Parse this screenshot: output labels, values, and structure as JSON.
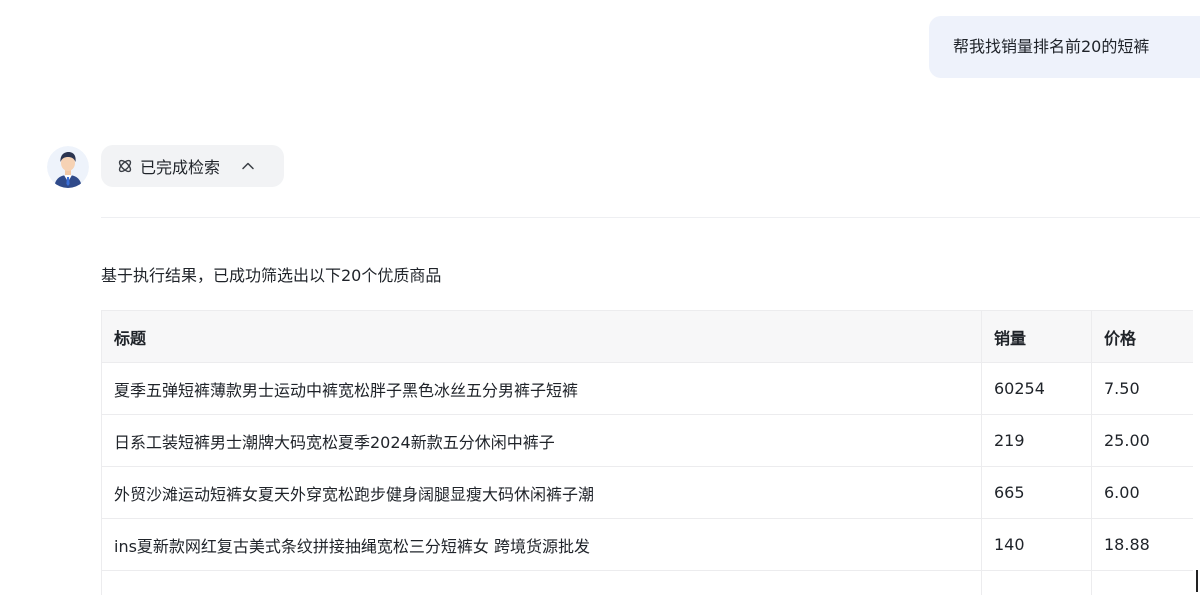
{
  "user_message": "帮我找销量排名前20的短裤",
  "assistant": {
    "avatar_icon": "user-avatar-icon",
    "status_label": "已完成检索",
    "status_icon": "search-done-icon",
    "collapse_icon": "chevron-up-icon",
    "summary": "基于执行结果，已成功筛选出以下20个优质商品"
  },
  "table": {
    "headers": {
      "title": "标题",
      "sales": "销量",
      "price": "价格"
    },
    "rows": [
      {
        "title": "夏季五弹短裤薄款男士运动中裤宽松胖子黑色冰丝五分男裤子短裤",
        "sales": "60254",
        "price": "7.50"
      },
      {
        "title": "日系工装短裤男士潮牌大码宽松夏季2024新款五分休闲中裤子",
        "sales": "219",
        "price": "25.00"
      },
      {
        "title": "外贸沙滩运动短裤女夏天外穿宽松跑步健身阔腿显瘦大码休闲裤子潮",
        "sales": "665",
        "price": "6.00"
      },
      {
        "title": "ins夏新款网红复古美式条纹拼接抽绳宽松三分短裤女 跨境货源批发",
        "sales": "140",
        "price": "18.88"
      },
      {
        "title": "",
        "sales": "",
        "price": ""
      }
    ]
  },
  "colors": {
    "user_bubble_bg": "#eef2fb",
    "pill_bg": "#f2f3f5",
    "table_header_bg": "#f7f7f8",
    "border": "#ececee"
  }
}
